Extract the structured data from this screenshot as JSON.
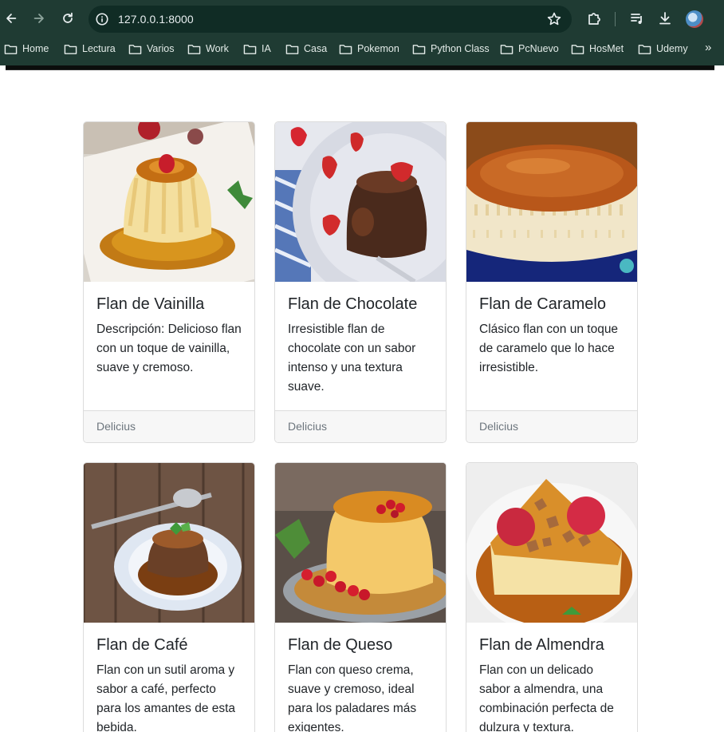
{
  "browser": {
    "url": "127.0.0.1:8000",
    "bookmarks": [
      "Home",
      "Lectura",
      "Varios",
      "Work",
      "IA",
      "Casa",
      "Pokemon",
      "Python Class",
      "PcNuevo",
      "HosMet",
      "Udemy"
    ],
    "more": "»"
  },
  "cards": [
    {
      "title": "Flan de Vainilla",
      "text": "Descripción: Delicioso flan con un toque de vainilla, suave y cremoso.",
      "footer": "Delicius",
      "image": "vanilla-flan-photo"
    },
    {
      "title": "Flan de Chocolate",
      "text": "Irresistible flan de chocolate con un sabor intenso y una textura suave.",
      "footer": "Delicius",
      "image": "chocolate-flan-photo"
    },
    {
      "title": "Flan de Caramelo",
      "text": "Clásico flan con un toque de caramelo que lo hace irresistible.",
      "footer": "Delicius",
      "image": "caramel-flan-photo"
    },
    {
      "title": "Flan de Café",
      "text": "Flan con un sutil aroma y sabor a café, perfecto para los amantes de esta bebida.",
      "image": "coffee-flan-photo"
    },
    {
      "title": "Flan de Queso",
      "text": "Flan con queso crema, suave y cremoso, ideal para los paladares más exigentes.",
      "image": "cheese-flan-photo"
    },
    {
      "title": "Flan de Almendra",
      "text": "Flan con un delicado sabor a almendra, una combinación perfecta de dulzura y textura.",
      "image": "almond-flan-photo"
    }
  ]
}
